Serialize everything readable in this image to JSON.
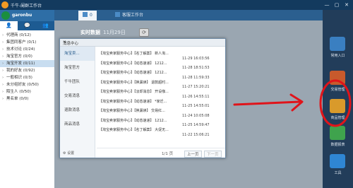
{
  "window": {
    "title": "千牛-阑群工作台",
    "controls": [
      "—",
      "▢",
      "✕"
    ]
  },
  "user": {
    "name": "garonbu"
  },
  "left_tabs": [
    "👤",
    "💬",
    "👥"
  ],
  "groups": [
    {
      "label": "代理商 (0/12)",
      "active": false
    },
    {
      "label": "集团同客户 (0/1)",
      "active": false
    },
    {
      "label": "技术讨论 (0/24)",
      "active": false
    },
    {
      "label": "淘宝官方 (0/0)",
      "active": false
    },
    {
      "label": "淘宝开发 (0/11)",
      "active": true
    },
    {
      "label": "我的好友 (0/92)",
      "active": false
    },
    {
      "label": "一般相识 (0/3)",
      "active": false
    },
    {
      "label": "未分组好友 (0/50)",
      "active": false
    },
    {
      "label": "陌生人 (0/50)",
      "active": false
    },
    {
      "label": "黑名单 (0/0)",
      "active": false
    }
  ],
  "top_tabs": [
    {
      "label": "0",
      "active": true
    },
    {
      "label": "客服工作台",
      "active": false
    }
  ],
  "realtime": {
    "label": "实时数据",
    "date": "11月29日",
    "refresh": "⟳"
  },
  "right_apps": [
    {
      "label": "常用入口",
      "icon": "home-icon",
      "color": "#3a7fc1"
    },
    {
      "label": "交易管理",
      "icon": "trade-icon",
      "color": "#c85a2c"
    },
    {
      "label": "商品管理",
      "icon": "goods-icon",
      "color": "#d99a2b"
    },
    {
      "label": "数据报表",
      "icon": "report-icon",
      "color": "#3fa34d"
    },
    {
      "label": "工具",
      "icon": "tool-icon",
      "color": "#2f86d3"
    }
  ],
  "popup": {
    "title": "消息中心",
    "close": "✕",
    "categories": [
      {
        "label": "淘宝卖...",
        "active": true
      },
      {
        "label": "淘宝官方",
        "active": false
      },
      {
        "label": "千牛团队",
        "active": false
      },
      {
        "label": "交易消息",
        "active": false
      },
      {
        "label": "退款消息",
        "active": false
      },
      {
        "label": "商品消息",
        "active": false
      }
    ],
    "settings": "设置",
    "messages": [
      {
        "text": "【淘宝卖家服务中心】【名丁解案】 新人淘...",
        "time": "11-29 16:03:56"
      },
      {
        "text": "【淘宝卖家服务中心】【动态速递】 1212...",
        "time": "11-28 18:51:53"
      },
      {
        "text": "【淘宝卖家服务中心】【动态速递】 1212...",
        "time": "11-28 11:59:33"
      },
      {
        "text": "【淘宝卖家服务中心】【换漏读】 退款超时...",
        "time": "11-27 15:20:21"
      },
      {
        "text": "【淘宝卖家服务中心】【淡却消息】 开设咖...",
        "time": "11-26 14:55:11"
      },
      {
        "text": "【淘宝卖家服务中心】【动态速递】 *家迁...",
        "time": "11-25 14:55:01"
      },
      {
        "text": "【淘宝卖家服务中心】【换漏读】 交易红...",
        "time": "11-24 10:05:08"
      },
      {
        "text": "【淘宝卖家服务中心】【动态速递】 1212...",
        "time": "11-25 14:59:47"
      },
      {
        "text": "【淘宝卖家服务中心】【名丁解案】 大促无...",
        "time": "11-22 15:06:21"
      }
    ],
    "pager": {
      "page": "1/1 页",
      "prev": "上一页",
      "next": "下一页"
    }
  }
}
